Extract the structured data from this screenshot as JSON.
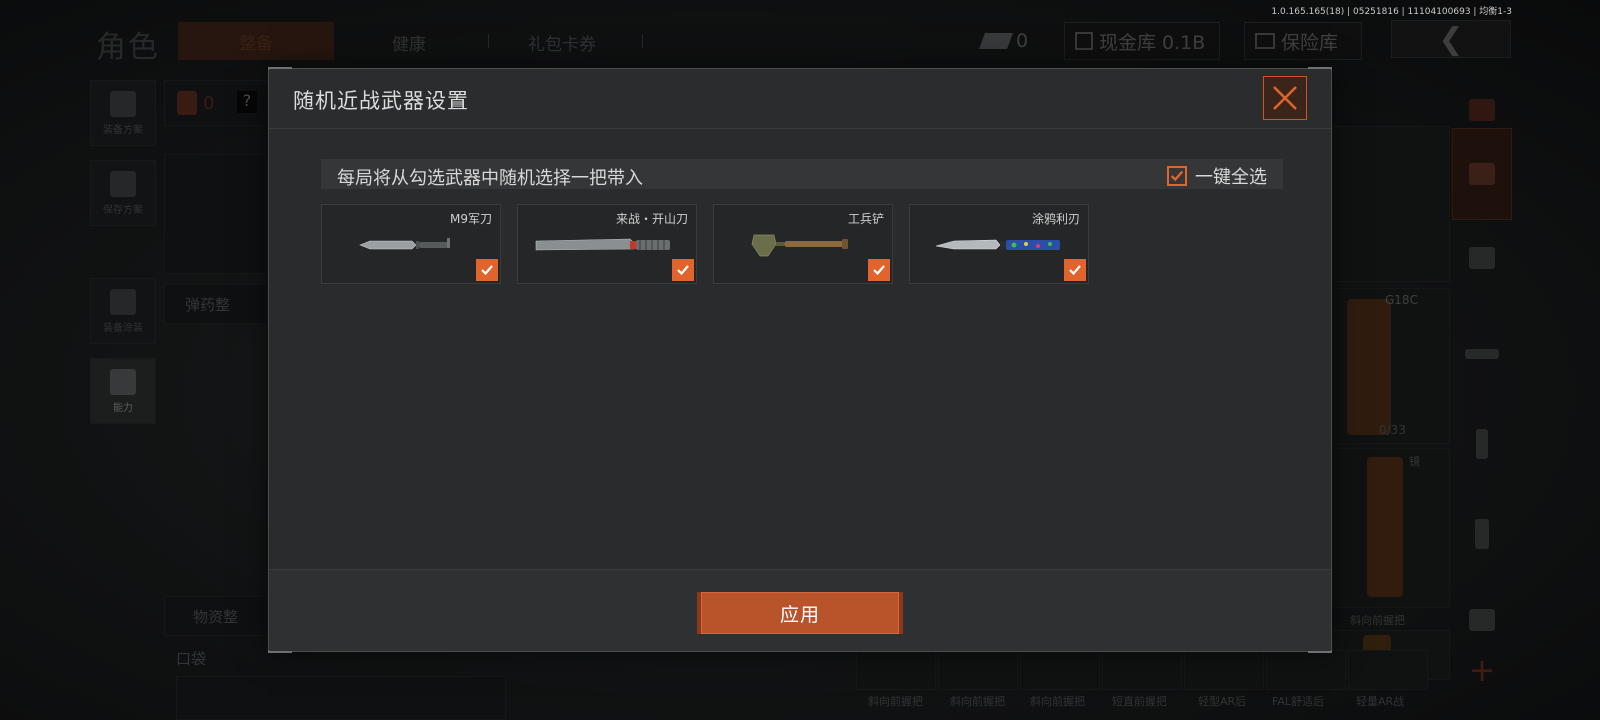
{
  "version_text": "1.0.165.165(18) | 05251816 | 11104100693 | 均衡1-3",
  "background": {
    "page_title": "角色",
    "tabs": [
      {
        "label": "整备",
        "active": true
      },
      {
        "label": "健康",
        "active": false
      },
      {
        "label": "礼包卡券",
        "active": false
      }
    ],
    "currency_count": "0",
    "cash_vault": "现金库 0.1B",
    "safe_vault": "保险库",
    "left_menu": [
      {
        "label": "装备方案"
      },
      {
        "label": "保存方案"
      },
      {
        "label": "装备涂装"
      },
      {
        "label": "能力"
      }
    ],
    "equip_count": "0",
    "help_symbol": "?",
    "ammo_box_label": "弹药整",
    "supplies_label": "物资整",
    "pocket_label": "口袋",
    "item_ammo": "0/33",
    "item_scope_label": "镜",
    "weapon_code": "G18C",
    "bottom_items": [
      "斜向前握把",
      "斜向前握把",
      "斜向前握把",
      "短直前握把",
      "轻型AR后",
      "FAL舒适后",
      "轻量AR战"
    ],
    "right_item_label": "斜向前握把"
  },
  "modal": {
    "title": "随机近战武器设置",
    "info_text": "每局将从勾选武器中随机选择一把带入",
    "select_all_label": "一键全选",
    "select_all_checked": true,
    "weapons": [
      {
        "name": "M9军刀",
        "checked": true,
        "icon": "bayonet-icon"
      },
      {
        "name": "来战・开山刀",
        "checked": true,
        "icon": "machete-icon"
      },
      {
        "name": "工兵铲",
        "checked": true,
        "icon": "shovel-icon"
      },
      {
        "name": "涂鸦利刃",
        "checked": true,
        "icon": "graffiti-blade-icon"
      }
    ],
    "apply_label": "应用"
  },
  "colors": {
    "accent": "#e0642c",
    "apply": "#b8532a",
    "modal_bg": "#292b2c"
  }
}
